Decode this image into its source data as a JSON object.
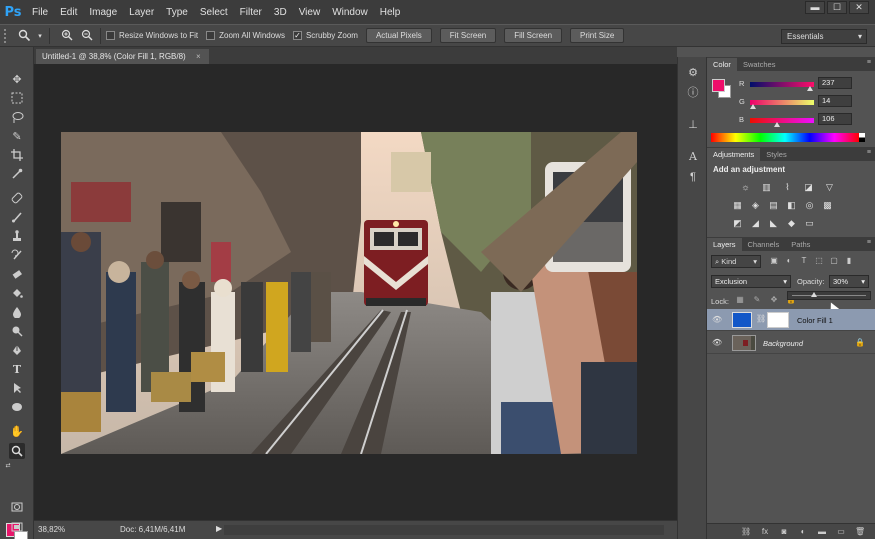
{
  "app": {
    "logo": "Ps"
  },
  "menu": [
    "File",
    "Edit",
    "Image",
    "Layer",
    "Type",
    "Select",
    "Filter",
    "3D",
    "View",
    "Window",
    "Help"
  ],
  "window_controls": [
    "▬",
    "☐",
    "✕"
  ],
  "options": {
    "resize_windows": "Resize Windows to Fit",
    "resize_checked": false,
    "zoom_all": "Zoom All Windows",
    "zoom_all_checked": false,
    "scrubby": "Scrubby Zoom",
    "scrubby_checked": true,
    "buttons": [
      "Actual Pixels",
      "Fit Screen",
      "Fill Screen",
      "Print Size"
    ],
    "workspace": "Essentials"
  },
  "document": {
    "tab_title": "Untitled-1 @ 38,8% (Color Fill 1, RGB/8)",
    "zoom": "38,82%",
    "doc_size": "Doc: 6,41M/6,41M"
  },
  "colors": {
    "foreground": "#e8176b",
    "background": "#ffffff",
    "accent_blue": "#2fa3f7",
    "fill_layer": "#1257c8"
  },
  "color_panel": {
    "tabs": [
      "Color",
      "Swatches"
    ],
    "channels": [
      {
        "label": "R",
        "value": "237",
        "fraction": 0.93
      },
      {
        "label": "G",
        "value": "14",
        "fraction": 0.05
      },
      {
        "label": "B",
        "value": "106",
        "fraction": 0.42
      }
    ]
  },
  "adjustments_panel": {
    "tabs": [
      "Adjustments",
      "Styles"
    ],
    "title": "Add an adjustment",
    "row1": [
      "brightness-icon",
      "levels-icon",
      "curves-icon",
      "exposure-icon",
      "gradient-triangle-icon"
    ],
    "row2": [
      "vibrance-icon",
      "hue-saturation-icon",
      "color-balance-icon",
      "black-white-icon",
      "photo-filter-icon",
      "channel-mixer-icon"
    ],
    "row3": [
      "invert-icon",
      "posterize-icon",
      "threshold-icon",
      "selective-color-icon",
      "gradient-map-icon"
    ]
  },
  "layers_panel": {
    "tabs": [
      "Layers",
      "Channels",
      "Paths"
    ],
    "kind": "Kind",
    "blend_mode": "Exclusion",
    "opacity_label": "Opacity:",
    "opacity": "30%",
    "opacity_fraction": 0.3,
    "lock_label": "Lock:",
    "layers": [
      {
        "name": "Color Fill 1",
        "selected": true
      },
      {
        "name": "Background",
        "selected": false
      }
    ]
  }
}
